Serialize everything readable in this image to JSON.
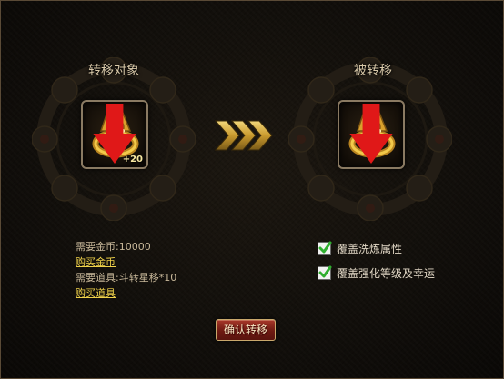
{
  "source_slot": {
    "title": "转移对象",
    "item_icon": "gold-ring-icon",
    "enhance_level": "+20",
    "indicator_icon": "red-down-arrow-icon"
  },
  "target_slot": {
    "title": "被转移",
    "item_icon": "gold-ring-icon",
    "indicator_icon": "red-down-arrow-icon"
  },
  "arrow_icon": "triple-chevron-right-icon",
  "cost": {
    "gold_label": "需要金币:10000",
    "buy_gold_link": "购买金币",
    "item_label": "需要道具:斗转星移*10",
    "buy_item_link": "购买道具"
  },
  "options": [
    {
      "label": "覆盖洗炼属性",
      "checked": true
    },
    {
      "label": "覆盖强化等级及幸运",
      "checked": true
    }
  ],
  "confirm_button": "确认转移",
  "colors": {
    "panel_border": "#5a4a36",
    "link": "#f0d24a",
    "text": "#c8b89a",
    "button_red": "#8a2518",
    "chevron_gold": "#c9a23a"
  }
}
